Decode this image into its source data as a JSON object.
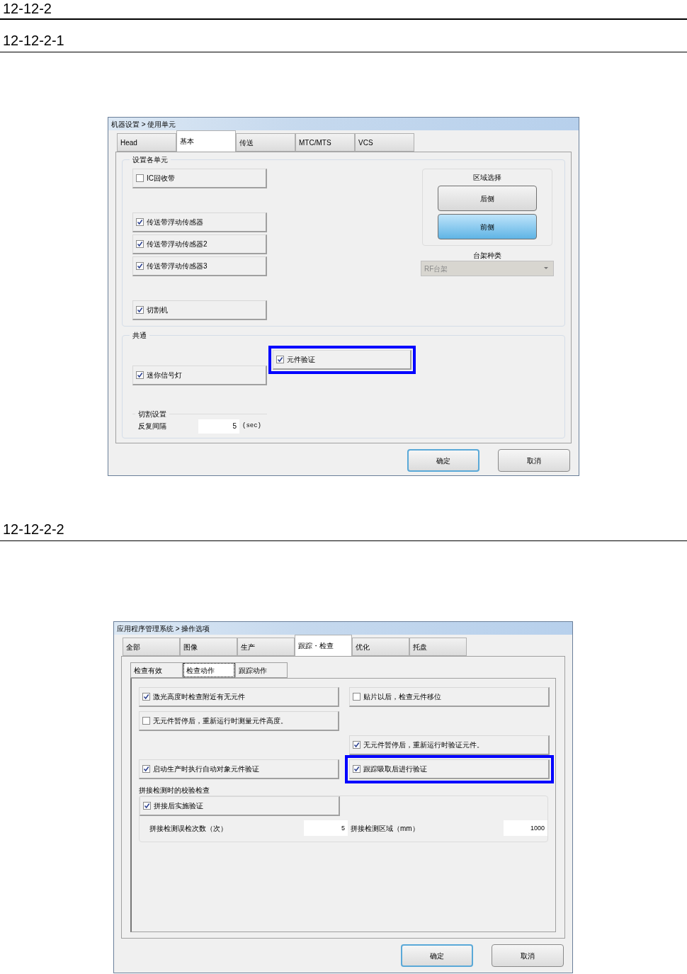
{
  "heading": "12-12-2",
  "subheading_1": "12-12-2-1",
  "dialog_1": {
    "title": "机器设置 > 使用单元",
    "tabs": [
      {
        "label": "Head",
        "selected": false
      },
      {
        "label": "基本",
        "selected": true
      },
      {
        "label": "传送",
        "selected": false
      },
      {
        "label": "MTC/MTS",
        "selected": false
      },
      {
        "label": "VCS",
        "selected": false
      }
    ],
    "units_group": {
      "title": "设置各单元",
      "checkbox_groups": [
        [
          {
            "label": "IC回收带",
            "checked": false
          }
        ],
        [
          {
            "label": "传送带浮动传感器",
            "checked": true
          },
          {
            "label": "传送带浮动传感器2",
            "checked": true
          },
          {
            "label": "传送带浮动传感器3",
            "checked": true
          }
        ],
        [
          {
            "label": "切割机",
            "checked": true
          }
        ]
      ],
      "area": {
        "title": "区域选择",
        "buttons": [
          {
            "label": "后侧",
            "selected": false
          },
          {
            "label": "前侧",
            "selected": true
          }
        ]
      },
      "rack": {
        "label": "台架种类",
        "value": "RF台架",
        "disabled": true
      }
    },
    "common_group": {
      "title": "共通",
      "left": [
        {
          "label": "迷你信号灯",
          "checked": true
        }
      ],
      "right": [
        {
          "label": "元件验证",
          "checked": true,
          "highlighted": true
        }
      ],
      "cut_settings": {
        "title": "切割设置",
        "label": "反复间隔",
        "value": "5",
        "unit": "(sec)"
      }
    },
    "buttons": [
      {
        "label": "确定",
        "default": true
      },
      {
        "label": "取消",
        "default": false
      }
    ]
  },
  "subheading_2": "12-12-2-2",
  "dialog_2": {
    "title": "应用程序管理系统 > 操作选项",
    "tabs": [
      {
        "label": "全部",
        "selected": false
      },
      {
        "label": "图像",
        "selected": false
      },
      {
        "label": "生产",
        "selected": false
      },
      {
        "label": "跟踪・检查",
        "selected": true
      },
      {
        "label": "优化",
        "selected": false
      },
      {
        "label": "托盘",
        "selected": false
      }
    ],
    "subtabs": [
      {
        "label": "检查有效",
        "selected": false
      },
      {
        "label": "检查动作",
        "selected": true
      },
      {
        "label": "跟踪动作",
        "selected": false
      }
    ],
    "rows": [
      {
        "left": {
          "label": "激光高度时检查附近有无元件",
          "checked": true,
          "highlighted": false
        },
        "right": {
          "label": "贴片以后，检查元件移位",
          "checked": false,
          "highlighted": false
        }
      },
      {
        "left": {
          "label": "无元件暂停后，重新运行时测量元件高度。",
          "checked": false,
          "highlighted": false
        }
      },
      {
        "right": {
          "label": "无元件暂停后，重新运行时验证元件。",
          "checked": true,
          "highlighted": false
        }
      },
      {
        "left": {
          "label": "启动生产时执行自动对象元件验证",
          "checked": true,
          "highlighted": false
        },
        "right": {
          "label": "跟踪吸取后进行验证",
          "checked": true,
          "highlighted": true
        }
      }
    ],
    "splice_group": {
      "title": "拼接检测时的校验检查",
      "option": {
        "label": "拼接后实施验证",
        "checked": true
      },
      "fields": [
        {
          "label": "拼接检测误检次数（次）",
          "value": "5"
        },
        {
          "label": "拼接检测区域（mm）",
          "value": "1000"
        }
      ]
    },
    "buttons": [
      {
        "label": "确定",
        "default": true
      },
      {
        "label": "取消",
        "default": false
      }
    ]
  }
}
